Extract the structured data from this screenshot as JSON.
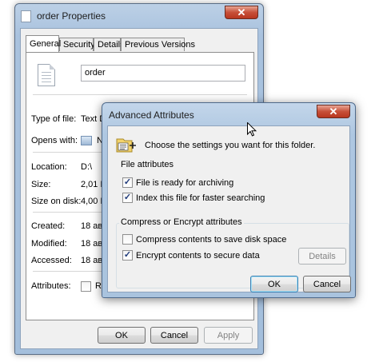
{
  "properties_window": {
    "title": "order Properties",
    "close_glyph": "✕",
    "tabs": [
      "General",
      "Security",
      "Details",
      "Previous Versions"
    ],
    "file_name": "order",
    "type_label": "Type of file:",
    "type_value": "Text Document (.txt)",
    "opens_label": "Opens with:",
    "opens_value": "No",
    "location_label": "Location:",
    "location_value": "D:\\",
    "size_label": "Size:",
    "size_value": "2,01 KE",
    "size_on_disk_label": "Size on disk:",
    "size_on_disk_value": "4,00 KE",
    "created_label": "Created:",
    "created_value": "18 авгу",
    "modified_label": "Modified:",
    "modified_value": "18 авгу",
    "accessed_label": "Accessed:",
    "accessed_value": "18 авгу",
    "attributes_label": "Attributes:",
    "readonly_label": "Rea",
    "ok_label": "OK",
    "cancel_label": "Cancel",
    "apply_label": "Apply"
  },
  "advanced_dialog": {
    "title": "Advanced Attributes",
    "close_glyph": "✕",
    "instruction": "Choose the settings you want for this folder.",
    "file_attributes_label": "File attributes",
    "archive_label": "File is ready for archiving",
    "archive_checked": true,
    "index_label": "Index this file for faster searching",
    "index_checked": true,
    "compress_group_label": "Compress or Encrypt attributes",
    "compress_label": "Compress contents to save disk space",
    "compress_checked": false,
    "encrypt_label": "Encrypt contents to secure data",
    "encrypt_checked": true,
    "details_label": "Details",
    "ok_label": "OK",
    "cancel_label": "Cancel",
    "check_glyph": "✓"
  }
}
